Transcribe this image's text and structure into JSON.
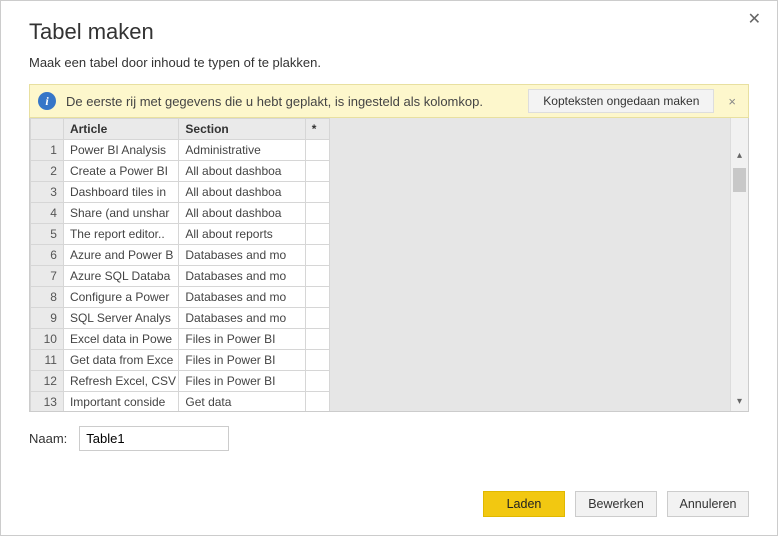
{
  "dialog": {
    "title": "Tabel maken",
    "subtitle": "Maak een tabel door inhoud te typen of te plakken.",
    "close_glyph": "✕"
  },
  "info": {
    "icon_glyph": "i",
    "text": "De eerste rij met gegevens die u hebt geplakt, is ingesteld als kolomkop.",
    "undo_label": "Kopteksten ongedaan maken",
    "close_glyph": "×"
  },
  "table": {
    "headers": {
      "col1": "Article",
      "col2": "Section",
      "extra": "*"
    },
    "rows": [
      {
        "n": "1",
        "article": "Power BI Analysis",
        "section": "Administrative"
      },
      {
        "n": "2",
        "article": "Create a Power BI",
        "section": "All about dashboa"
      },
      {
        "n": "3",
        "article": "Dashboard tiles in",
        "section": "All about dashboa"
      },
      {
        "n": "4",
        "article": "Share (and unshar",
        "section": "All about dashboa"
      },
      {
        "n": "5",
        "article": "The report editor..",
        "section": "All about reports"
      },
      {
        "n": "6",
        "article": "Azure and Power B",
        "section": "Databases and mo"
      },
      {
        "n": "7",
        "article": "Azure SQL Databa",
        "section": "Databases and mo"
      },
      {
        "n": "8",
        "article": "Configure a Power",
        "section": "Databases and mo"
      },
      {
        "n": "9",
        "article": "SQL Server Analys",
        "section": "Databases and mo"
      },
      {
        "n": "10",
        "article": "Excel data in Powe",
        "section": "Files in Power BI"
      },
      {
        "n": "11",
        "article": "Get data from Exce",
        "section": "Files in Power BI"
      },
      {
        "n": "12",
        "article": "Refresh Excel, CSV",
        "section": "Files in Power BI"
      },
      {
        "n": "13",
        "article": "Important conside",
        "section": "Get data"
      }
    ]
  },
  "name": {
    "label": "Naam:",
    "value": "Table1"
  },
  "buttons": {
    "load": "Laden",
    "edit": "Bewerken",
    "cancel": "Annuleren"
  },
  "scroll": {
    "up": "▴",
    "down": "▾"
  }
}
